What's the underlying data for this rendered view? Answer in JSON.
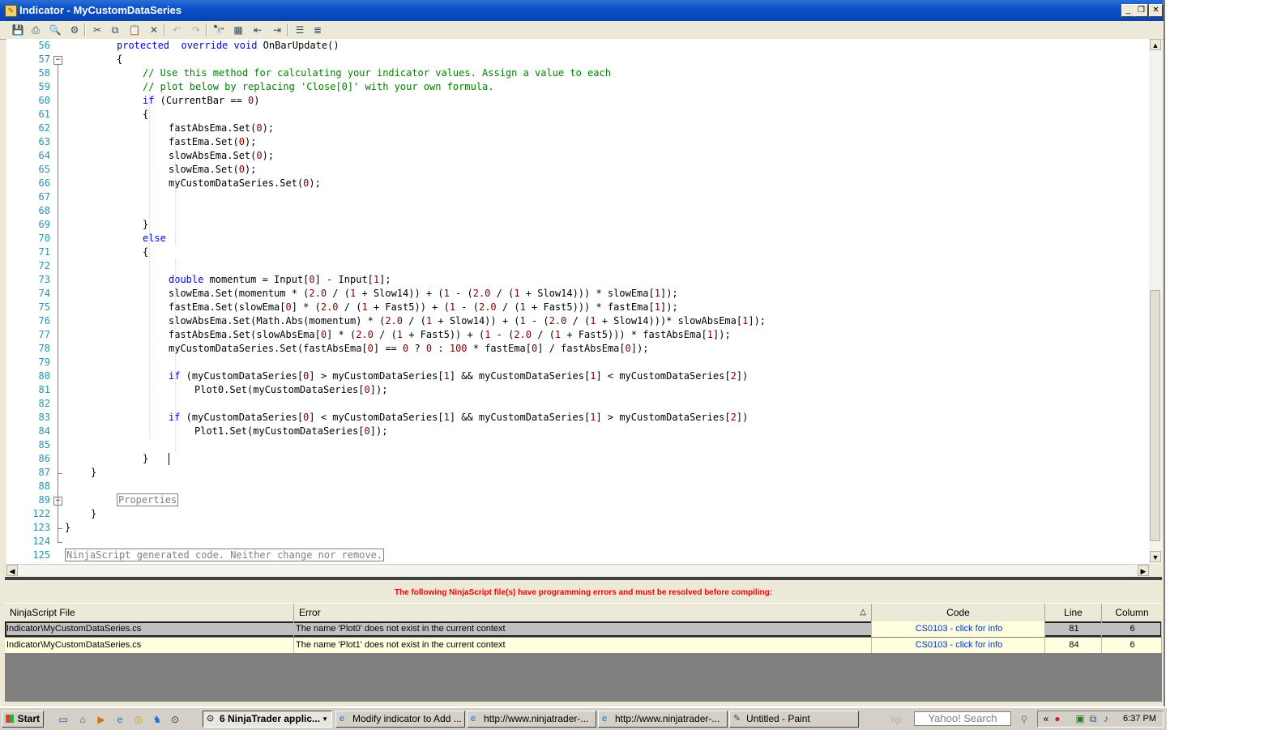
{
  "window": {
    "title": "Indicator - MyCustomDataSeries",
    "controls": {
      "minimize": "_",
      "restore": "❐",
      "close": "✕"
    }
  },
  "toolbar": [
    {
      "name": "save",
      "glyph": "💾",
      "enabled": true
    },
    {
      "name": "print",
      "glyph": "⎙",
      "enabled": true
    },
    {
      "name": "print-preview",
      "glyph": "🔍",
      "enabled": true
    },
    {
      "name": "page-setup",
      "glyph": "⚙",
      "enabled": true
    },
    {
      "name": "cut",
      "glyph": "✂",
      "enabled": true
    },
    {
      "name": "copy",
      "glyph": "⧉",
      "enabled": true
    },
    {
      "name": "paste",
      "glyph": "📋",
      "enabled": true
    },
    {
      "name": "delete",
      "glyph": "✕",
      "enabled": true
    },
    {
      "name": "undo",
      "glyph": "↶",
      "enabled": false
    },
    {
      "name": "redo",
      "glyph": "↷",
      "enabled": false
    },
    {
      "name": "find",
      "glyph": "🔭",
      "enabled": true
    },
    {
      "name": "find-replace",
      "glyph": "▦",
      "enabled": true
    },
    {
      "name": "outdent",
      "glyph": "⇤",
      "enabled": true
    },
    {
      "name": "indent",
      "glyph": "⇥",
      "enabled": true
    },
    {
      "name": "comment",
      "glyph": "☰",
      "enabled": true
    },
    {
      "name": "uncomment",
      "glyph": "≣",
      "enabled": true
    }
  ],
  "code_lines": [
    {
      "n": "56",
      "ind": 2,
      "segs": [
        [
          "kw",
          "protected"
        ],
        [
          "",
          "  "
        ],
        [
          "kw",
          "override"
        ],
        [
          "",
          " "
        ],
        [
          "kw",
          "void"
        ],
        [
          "",
          " OnBarUpdate()"
        ]
      ]
    },
    {
      "n": "57",
      "ind": 2,
      "segs": [
        [
          "",
          "{"
        ]
      ]
    },
    {
      "n": "58",
      "ind": 3,
      "segs": [
        [
          "cm",
          "// Use this method for calculating your indicator values. Assign a value to each"
        ]
      ]
    },
    {
      "n": "59",
      "ind": 3,
      "segs": [
        [
          "cm",
          "// plot below by replacing 'Close[0]' with your own formula."
        ]
      ]
    },
    {
      "n": "60",
      "ind": 3,
      "segs": [
        [
          "kw",
          "if"
        ],
        [
          "",
          " (CurrentBar == "
        ],
        [
          "num",
          "0"
        ],
        [
          "",
          ")"
        ]
      ]
    },
    {
      "n": "61",
      "ind": 3,
      "segs": [
        [
          "",
          "{"
        ]
      ]
    },
    {
      "n": "62",
      "ind": 4,
      "segs": [
        [
          "",
          "fastAbsEma.Set("
        ],
        [
          "num",
          "0"
        ],
        [
          "",
          ");"
        ]
      ]
    },
    {
      "n": "63",
      "ind": 4,
      "segs": [
        [
          "",
          "fastEma.Set("
        ],
        [
          "num",
          "0"
        ],
        [
          "",
          ");"
        ]
      ]
    },
    {
      "n": "64",
      "ind": 4,
      "segs": [
        [
          "",
          "slowAbsEma.Set("
        ],
        [
          "num",
          "0"
        ],
        [
          "",
          ");"
        ]
      ]
    },
    {
      "n": "65",
      "ind": 4,
      "segs": [
        [
          "",
          "slowEma.Set("
        ],
        [
          "num",
          "0"
        ],
        [
          "",
          ");"
        ]
      ]
    },
    {
      "n": "66",
      "ind": 4,
      "segs": [
        [
          "",
          "myCustomDataSeries.Set("
        ],
        [
          "num",
          "0"
        ],
        [
          "",
          ");"
        ]
      ]
    },
    {
      "n": "67",
      "ind": 0,
      "segs": []
    },
    {
      "n": "68",
      "ind": 0,
      "segs": []
    },
    {
      "n": "69",
      "ind": 3,
      "segs": [
        [
          "",
          "}"
        ]
      ]
    },
    {
      "n": "70",
      "ind": 3,
      "segs": [
        [
          "kw",
          "else"
        ]
      ]
    },
    {
      "n": "71",
      "ind": 3,
      "segs": [
        [
          "",
          "{"
        ]
      ]
    },
    {
      "n": "72",
      "ind": 0,
      "segs": []
    },
    {
      "n": "73",
      "ind": 4,
      "segs": [
        [
          "kw",
          "double"
        ],
        [
          "",
          " momentum = Input["
        ],
        [
          "num",
          "0"
        ],
        [
          "",
          "] - Input["
        ],
        [
          "num",
          "1"
        ],
        [
          "",
          "];"
        ]
      ]
    },
    {
      "n": "74",
      "ind": 4,
      "segs": [
        [
          "",
          "slowEma.Set(momentum * ("
        ],
        [
          "num",
          "2.0"
        ],
        [
          "",
          " / ("
        ],
        [
          "num",
          "1"
        ],
        [
          "",
          " + Slow14)) + ("
        ],
        [
          "num",
          "1"
        ],
        [
          "",
          " - ("
        ],
        [
          "num",
          "2.0"
        ],
        [
          "",
          " / ("
        ],
        [
          "num",
          "1"
        ],
        [
          "",
          " + Slow14))) * slowEma["
        ],
        [
          "num",
          "1"
        ],
        [
          "",
          "]);"
        ]
      ]
    },
    {
      "n": "75",
      "ind": 4,
      "segs": [
        [
          "",
          "fastEma.Set(slowEma["
        ],
        [
          "num",
          "0"
        ],
        [
          "",
          "] * ("
        ],
        [
          "num",
          "2.0"
        ],
        [
          "",
          " / ("
        ],
        [
          "num",
          "1"
        ],
        [
          "",
          " + Fast5)) + ("
        ],
        [
          "num",
          "1"
        ],
        [
          "",
          " - ("
        ],
        [
          "num",
          "2.0"
        ],
        [
          "",
          " / ("
        ],
        [
          "num",
          "1"
        ],
        [
          "",
          " + Fast5))) * fastEma["
        ],
        [
          "num",
          "1"
        ],
        [
          "",
          "]);"
        ]
      ]
    },
    {
      "n": "76",
      "ind": 4,
      "segs": [
        [
          "",
          "slowAbsEma.Set(Math.Abs(momentum) * ("
        ],
        [
          "num",
          "2.0"
        ],
        [
          "",
          " / ("
        ],
        [
          "num",
          "1"
        ],
        [
          "",
          " + Slow14)) + ("
        ],
        [
          "num",
          "1"
        ],
        [
          "",
          " - ("
        ],
        [
          "num",
          "2.0"
        ],
        [
          "",
          " / ("
        ],
        [
          "num",
          "1"
        ],
        [
          "",
          " + Slow14)))* slowAbsEma["
        ],
        [
          "num",
          "1"
        ],
        [
          "",
          "]);"
        ]
      ]
    },
    {
      "n": "77",
      "ind": 4,
      "segs": [
        [
          "",
          "fastAbsEma.Set(slowAbsEma["
        ],
        [
          "num",
          "0"
        ],
        [
          "",
          "] * ("
        ],
        [
          "num",
          "2.0"
        ],
        [
          "",
          " / ("
        ],
        [
          "num",
          "1"
        ],
        [
          "",
          " + Fast5)) + ("
        ],
        [
          "num",
          "1"
        ],
        [
          "",
          " - ("
        ],
        [
          "num",
          "2.0"
        ],
        [
          "",
          " / ("
        ],
        [
          "num",
          "1"
        ],
        [
          "",
          " + Fast5))) * fastAbsEma["
        ],
        [
          "num",
          "1"
        ],
        [
          "",
          "]);"
        ]
      ]
    },
    {
      "n": "78",
      "ind": 4,
      "segs": [
        [
          "",
          "myCustomDataSeries.Set(fastAbsEma["
        ],
        [
          "num",
          "0"
        ],
        [
          "",
          "] == "
        ],
        [
          "num",
          "0"
        ],
        [
          "",
          " ? "
        ],
        [
          "num",
          "0"
        ],
        [
          "",
          " : "
        ],
        [
          "num",
          "100"
        ],
        [
          "",
          " * fastEma["
        ],
        [
          "num",
          "0"
        ],
        [
          "",
          "] / fastAbsEma["
        ],
        [
          "num",
          "0"
        ],
        [
          "",
          "]);"
        ]
      ]
    },
    {
      "n": "79",
      "ind": 0,
      "segs": []
    },
    {
      "n": "80",
      "ind": 4,
      "segs": [
        [
          "kw",
          "if"
        ],
        [
          "",
          " (myCustomDataSeries["
        ],
        [
          "num",
          "0"
        ],
        [
          "",
          "] > myCustomDataSeries["
        ],
        [
          "num",
          "1"
        ],
        [
          "",
          "] && myCustomDataSeries["
        ],
        [
          "num",
          "1"
        ],
        [
          "",
          "] < myCustomDataSeries["
        ],
        [
          "num",
          "2"
        ],
        [
          "",
          "])"
        ]
      ]
    },
    {
      "n": "81",
      "ind": 5,
      "segs": [
        [
          "",
          "Plot0.Set(myCustomDataSeries["
        ],
        [
          "num",
          "0"
        ],
        [
          "",
          "]);"
        ]
      ]
    },
    {
      "n": "82",
      "ind": 0,
      "segs": []
    },
    {
      "n": "83",
      "ind": 4,
      "segs": [
        [
          "kw",
          "if"
        ],
        [
          "",
          " (myCustomDataSeries["
        ],
        [
          "num",
          "0"
        ],
        [
          "",
          "] < myCustomDataSeries["
        ],
        [
          "num",
          "1"
        ],
        [
          "",
          "] && myCustomDataSeries["
        ],
        [
          "num",
          "1"
        ],
        [
          "",
          "] > myCustomDataSeries["
        ],
        [
          "num",
          "2"
        ],
        [
          "",
          "])"
        ]
      ]
    },
    {
      "n": "84",
      "ind": 5,
      "segs": [
        [
          "",
          "Plot1.Set(myCustomDataSeries["
        ],
        [
          "num",
          "0"
        ],
        [
          "",
          "]);"
        ]
      ]
    },
    {
      "n": "85",
      "ind": 0,
      "segs": []
    },
    {
      "n": "86",
      "ind": 3,
      "segs": [
        [
          "",
          "}"
        ]
      ]
    },
    {
      "n": "87",
      "ind": 1,
      "segs": [
        [
          "",
          "}"
        ]
      ]
    },
    {
      "n": "88",
      "ind": 0,
      "segs": []
    },
    {
      "n": "89",
      "ind": 2,
      "segs": [
        [
          "region",
          "Properties"
        ]
      ]
    },
    {
      "n": "122",
      "ind": 1,
      "segs": [
        [
          "",
          "}"
        ]
      ]
    },
    {
      "n": "123",
      "ind": 0,
      "segs": [
        [
          "",
          "}"
        ]
      ]
    },
    {
      "n": "124",
      "ind": 0,
      "segs": []
    },
    {
      "n": "125",
      "ind": 0,
      "segs": [
        [
          "region",
          "NinjaScript generated code. Neither change nor remove."
        ]
      ]
    }
  ],
  "errors": {
    "message": "The following NinjaScript file(s) have programming errors and must be resolved before compiling:",
    "columns": [
      "NinjaScript File",
      "Error",
      "Code",
      "Line",
      "Column"
    ],
    "sort_indicator": "△",
    "rows": [
      {
        "file": "Indicator\\MyCustomDataSeries.cs",
        "error": "The name 'Plot0' does not exist in the current context",
        "code": "CS0103 - click for info",
        "line": "81",
        "column": "6"
      },
      {
        "file": "Indicator\\MyCustomDataSeries.cs",
        "error": "The name 'Plot1' does not exist in the current context",
        "code": "CS0103 - click for info",
        "line": "84",
        "column": "6"
      }
    ]
  },
  "taskbar": {
    "start": "Start",
    "tasks": [
      {
        "label": "6 NinjaTrader applic...",
        "icon": "⊙",
        "active": true
      },
      {
        "label": "Modify indicator to Add ...",
        "icon": "e",
        "active": false
      },
      {
        "label": "http://www.ninjatrader-...",
        "icon": "e",
        "active": false
      },
      {
        "label": "http://www.ninjatrader-...",
        "icon": "e",
        "active": false
      },
      {
        "label": "Untitled - Paint",
        "icon": "✎",
        "active": false
      }
    ],
    "search": "Yahoo! Search",
    "tray_expand": "«",
    "clock": "6:37 PM"
  },
  "colors": {
    "accent": "#0a50c8",
    "error": "#ff0000",
    "selected_row": "#c0c0c0",
    "row": "#ffffe0"
  }
}
